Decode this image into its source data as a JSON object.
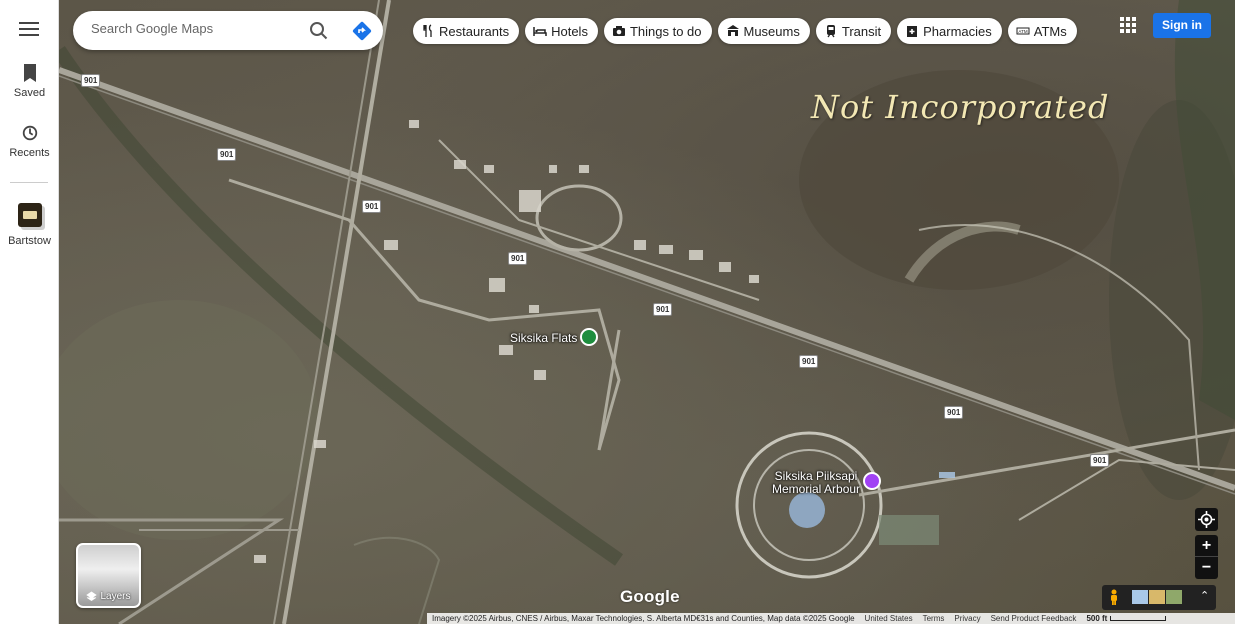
{
  "rail": {
    "saved_label": "Saved",
    "recents_label": "Recents",
    "recent_place_label": "Bartstow"
  },
  "search": {
    "placeholder": "Search Google Maps"
  },
  "chips": [
    {
      "label": "Restaurants",
      "icon": "fork-knife-icon"
    },
    {
      "label": "Hotels",
      "icon": "bed-icon"
    },
    {
      "label": "Things to do",
      "icon": "camera-icon"
    },
    {
      "label": "Museums",
      "icon": "museum-icon"
    },
    {
      "label": "Transit",
      "icon": "train-icon"
    },
    {
      "label": "Pharmacies",
      "icon": "pharmacy-icon"
    },
    {
      "label": "ATMs",
      "icon": "atm-icon"
    }
  ],
  "header": {
    "signin_label": "Sign in"
  },
  "map": {
    "area_overlay_text": "Not Incorporated",
    "places": [
      {
        "name": "Siksika Flats",
        "icon": "park-pin-icon",
        "color": "#1e8e3e"
      },
      {
        "name_line1": "Siksika Piiksapi",
        "name_line2": "Memorial Arbour",
        "icon": "landmark-pin-icon",
        "color": "#a142f4"
      }
    ],
    "highway_labels": [
      "901",
      "901",
      "901",
      "901",
      "901",
      "901",
      "901",
      "901"
    ]
  },
  "layers": {
    "label": "Layers"
  },
  "logo_text": "Google",
  "zoom": {
    "in_label": "+",
    "out_label": "−"
  },
  "footer": {
    "attribution": "Imagery ©2025 Airbus, CNES / Airbus, Maxar Technologies, S. Alberta MD€31s and Counties, Map data ©2025 Google",
    "region": "United States",
    "terms": "Terms",
    "privacy": "Privacy",
    "feedback": "Send Product Feedback",
    "scale": "500 ft"
  },
  "colors": {
    "signin_blue": "#1a73e8",
    "overlay_text": "#f3e8b4"
  }
}
